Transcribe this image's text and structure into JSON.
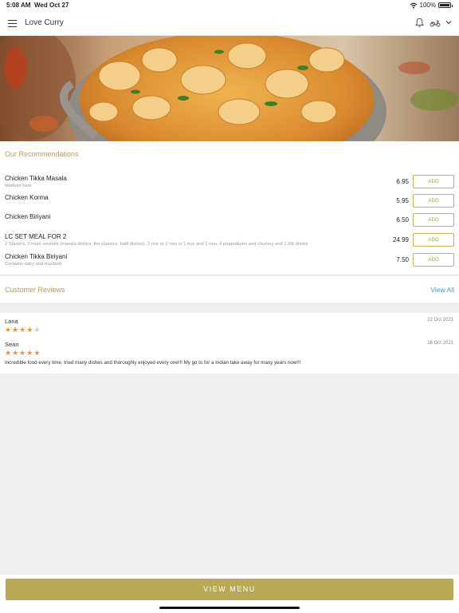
{
  "status_bar": {
    "time": "5:08 AM",
    "date": "Wed Oct 27",
    "battery": "100%"
  },
  "header": {
    "title": "Love Curry"
  },
  "recommendations": {
    "title": "Our Recommendations",
    "add_label": "ADD",
    "items": [
      {
        "name": "Chicken Tikka Masala",
        "desc": "Medium heat",
        "price": "6.95"
      },
      {
        "name": "Chicken Korma",
        "desc": "",
        "price": "5.95"
      },
      {
        "name": "Chicken Biriyani",
        "desc": "",
        "price": "6.50"
      },
      {
        "name": "LC SET MEAL FOR 2",
        "desc": "2 Starters, 2 main courses (masala dishes, the classics, balti dishes), 2 rice or 2 nan or 1 rice and 1 nan, 4 poppodums and chutney and 1.5ltr drinks",
        "price": "24.99"
      },
      {
        "name": "Chicken Tikka Biriyani",
        "desc": "Contains dairy and mustard",
        "price": "7.50"
      }
    ]
  },
  "reviews": {
    "title": "Customer Reviews",
    "view_all": "View All",
    "items": [
      {
        "name": "Lana",
        "date": "22 Oct 2021",
        "rating": 4,
        "text": ""
      },
      {
        "name": "Sean",
        "date": "16 Oct 2021",
        "rating": 5,
        "text": "Incredible food every time, tried many dishes and thoroughly enjoyed every one!!! My go to for a Indian take away for many years now!!!"
      }
    ]
  },
  "footer": {
    "view_menu": "VIEW MENU"
  },
  "colors": {
    "accent": "#b9a855",
    "link": "#3e9bd3",
    "star": "#e8923a"
  }
}
